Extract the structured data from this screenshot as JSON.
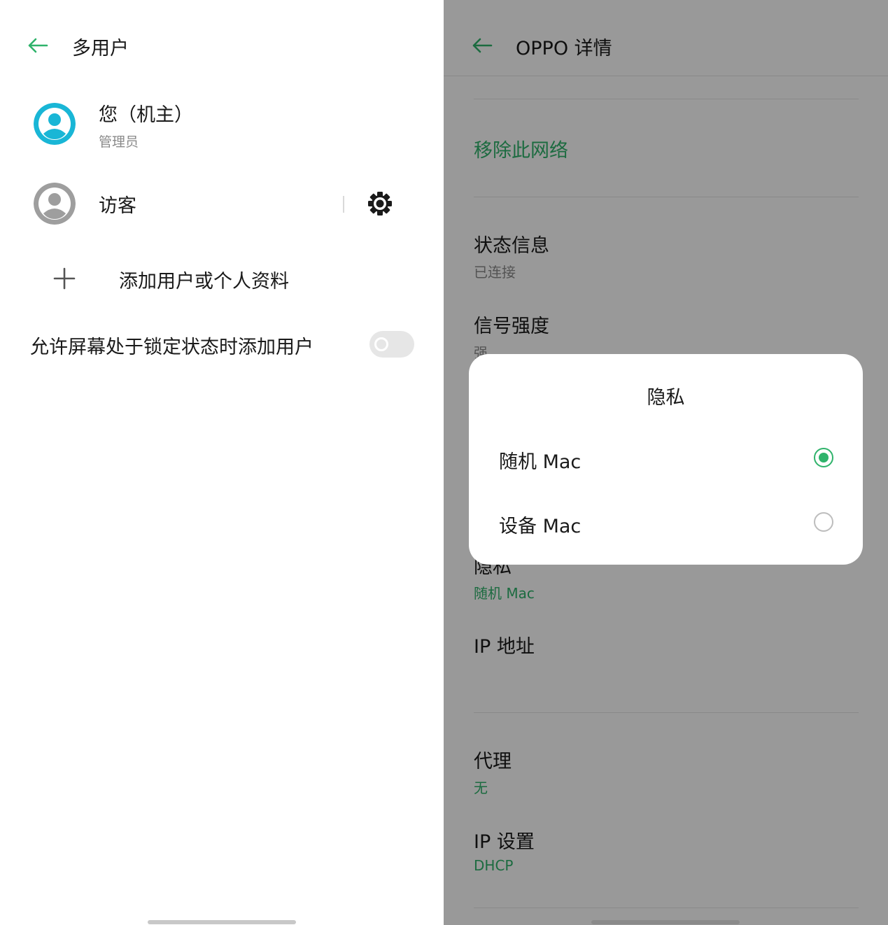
{
  "colors": {
    "accent": "#2fb36b",
    "avatar_owner": "#19b6d6",
    "avatar_guest": "#9e9e9e"
  },
  "left": {
    "header": {
      "back_icon": "back-arrow-icon",
      "title": "多用户"
    },
    "users": [
      {
        "name": "您（机主）",
        "role": "管理员",
        "icon": "user-avatar-icon"
      },
      {
        "name": "访客",
        "icon": "user-avatar-icon",
        "settings_icon": "gear-icon"
      }
    ],
    "add_user": {
      "icon": "plus-icon",
      "label": "添加用户或个人资料"
    },
    "lock_screen_add": {
      "label": "允许屏幕处于锁定状态时添加用户",
      "enabled": false
    }
  },
  "right": {
    "header": {
      "back_icon": "back-arrow-icon",
      "title": "OPPO 详情"
    },
    "remove_network": "移除此网络",
    "status": {
      "title": "状态信息",
      "value": "已连接"
    },
    "signal": {
      "title": "信号强度",
      "value": "强"
    },
    "privacy_row": {
      "title": "隐私",
      "value": "随机 Mac"
    },
    "ip_address": {
      "title": "IP 地址"
    },
    "proxy": {
      "title": "代理",
      "value": "无"
    },
    "ip_settings": {
      "title": "IP 设置",
      "value": "DHCP"
    },
    "dialog": {
      "title": "隐私",
      "options": [
        {
          "label": "随机 Mac",
          "selected": true
        },
        {
          "label": "设备 Mac",
          "selected": false
        }
      ]
    }
  }
}
